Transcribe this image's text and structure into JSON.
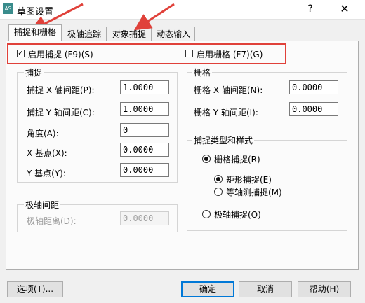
{
  "window": {
    "app_icon_text": "AS",
    "title": "草图设置",
    "help_glyph": "?",
    "close_glyph": "✕"
  },
  "tabs": [
    {
      "label": "捕捉和栅格"
    },
    {
      "label": "极轴追踪"
    },
    {
      "label": "对象捕捉"
    },
    {
      "label": "动态输入"
    }
  ],
  "toggles": {
    "snap_on": {
      "label": "启用捕捉 (F9)(S)",
      "checked": true
    },
    "grid_on": {
      "label": "启用栅格 (F7)(G)",
      "checked": false
    }
  },
  "snap": {
    "title": "捕捉",
    "x_spacing": {
      "label": "捕捉 X 轴间距(P):",
      "value": "1.0000"
    },
    "y_spacing": {
      "label": "捕捉 Y 轴间距(C):",
      "value": "1.0000"
    },
    "angle": {
      "label": "角度(A):",
      "value": "0"
    },
    "x_base": {
      "label": "X 基点(X):",
      "value": "0.0000"
    },
    "y_base": {
      "label": "Y 基点(Y):",
      "value": "0.0000"
    }
  },
  "polar": {
    "title": "极轴间距",
    "distance": {
      "label": "极轴距离(D):",
      "value": "0.0000"
    }
  },
  "grid": {
    "title": "栅格",
    "x_spacing": {
      "label": "栅格 X 轴间距(N):",
      "value": "0.0000"
    },
    "y_spacing": {
      "label": "栅格 Y 轴间距(I):",
      "value": "0.0000"
    }
  },
  "snap_type": {
    "title": "捕捉类型和样式",
    "grid_snap": "栅格捕捉(R)",
    "rectangular": "矩形捕捉(E)",
    "isometric": "等轴测捕捉(M)",
    "polar_snap": "极轴捕捉(O)"
  },
  "buttons": {
    "options": "选项(T)...",
    "ok": "确定",
    "cancel": "取消",
    "help": "帮助(H)"
  },
  "colors": {
    "annotation": "#e0413a",
    "default_button_border": "#0078d7"
  }
}
